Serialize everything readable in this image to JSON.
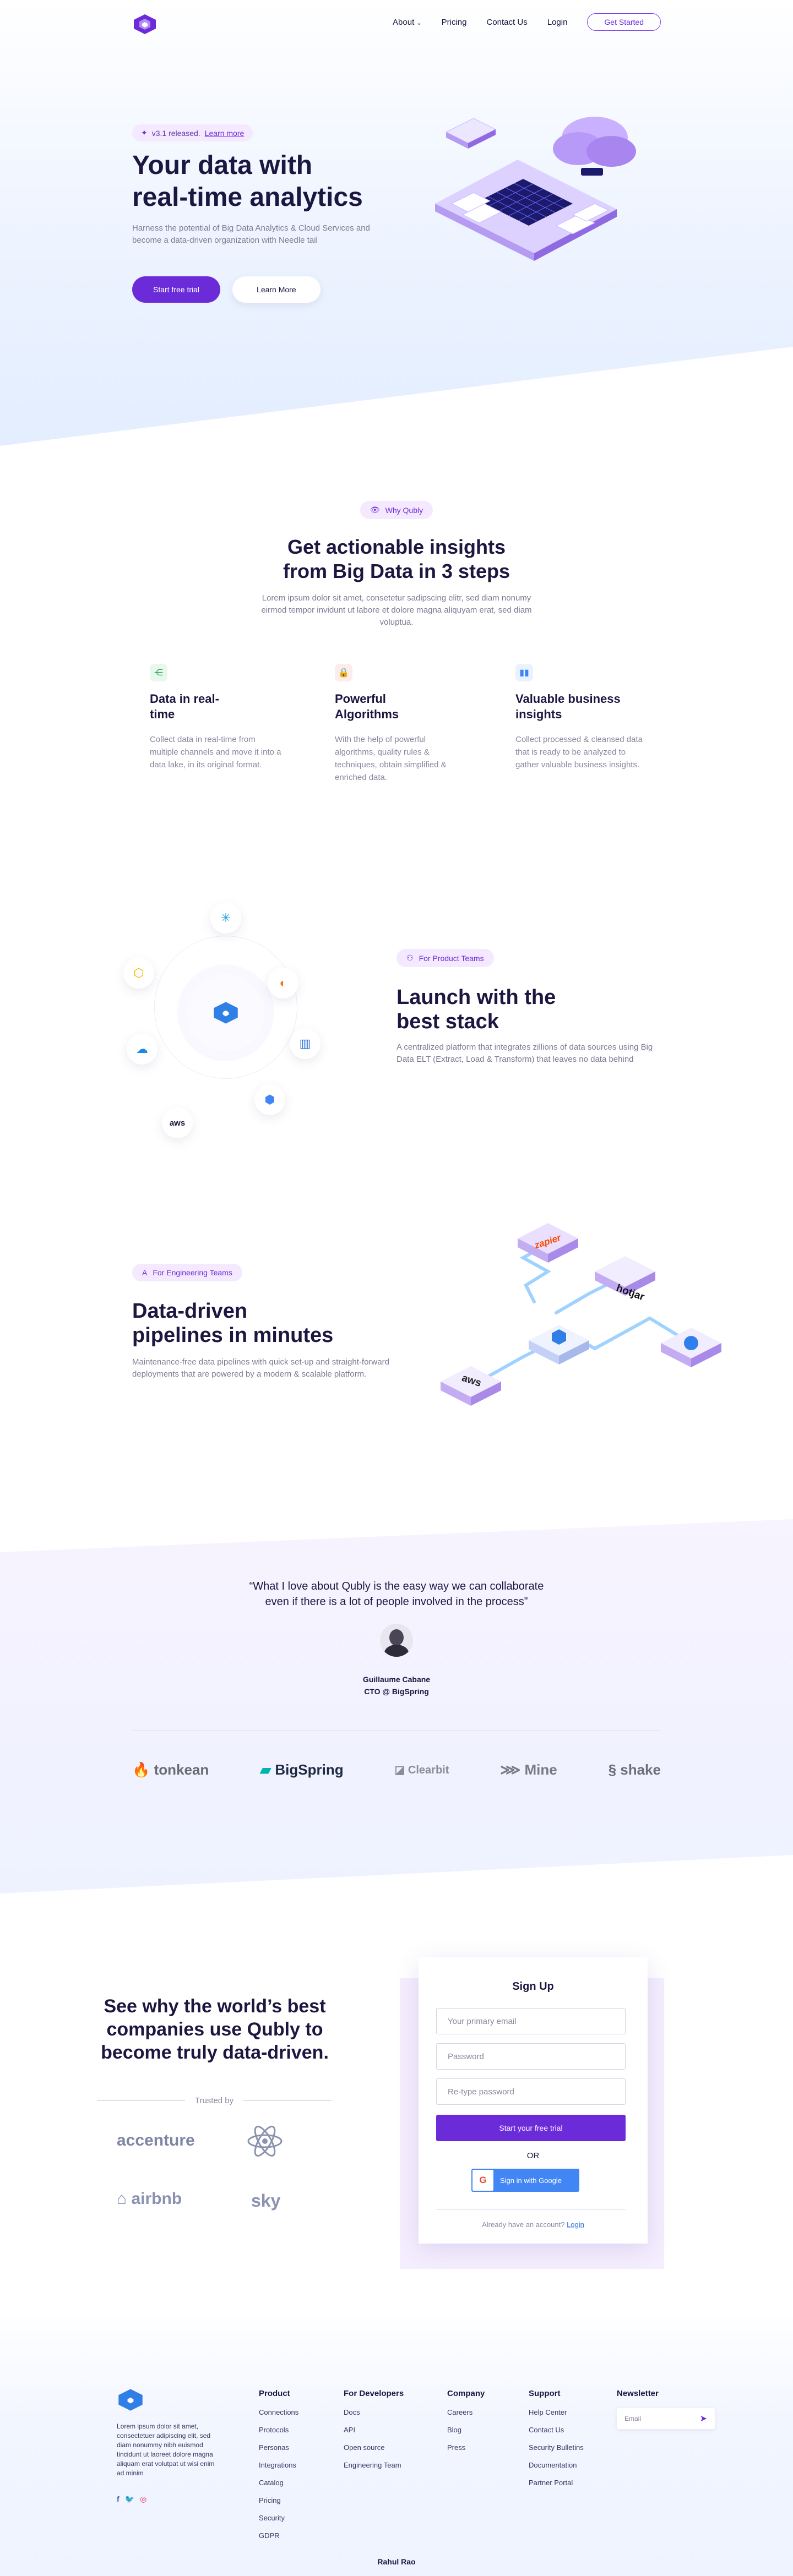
{
  "nav": {
    "links": [
      "About",
      "Pricing",
      "Contact Us",
      "Login"
    ],
    "about_chevron": "⌄",
    "cta": "Get Started"
  },
  "hero": {
    "badge_text": "v3.1 released.",
    "badge_link": "Learn more",
    "title_line1": "Your data with",
    "title_line2": "real-time analytics",
    "subtitle": "Harness the potential of Big Data Analytics & Cloud Services and become a data-driven organization with Needle tail",
    "primary_button": "Start free trial",
    "secondary_button": "Learn More"
  },
  "why": {
    "tag": "Why Qubly",
    "title_line1": "Get actionable insights",
    "title_line2": "from Big Data in 3 steps",
    "description": "Lorem ipsum dolor sit amet, consetetur sadipscing elitr, sed diam nonumy eirmod tempor invidunt ut labore et dolore magna aliquyam erat, sed diam voluptua.",
    "features": [
      {
        "title_line1": "Data in real-",
        "title_line2": "time",
        "text": "Collect data in real-time from multiple channels and move it into a data lake, in its original format.",
        "icon": "share-icon",
        "color": "#27a745"
      },
      {
        "title_line1": "Powerful",
        "title_line2": "Algorithms",
        "text": "With the help of powerful algorithms, quality rules & techniques, obtain simplified & enriched data.",
        "icon": "lock-icon",
        "color": "#e5484d"
      },
      {
        "title_line1": "Valuable business",
        "title_line2": "insights",
        "text": "Collect processed & cleansed data that is ready to be analyzed to gather valuable business insights.",
        "icon": "bar-chart-icon",
        "color": "#3b82f6"
      }
    ]
  },
  "stack": {
    "tag": "For Product Teams",
    "title_line1": "Launch with the",
    "title_line2": "best stack",
    "description": "A centralized platform that integrates zillions of data sources using Big Data ELT (Extract, Load & Transform) that leaves no data behind",
    "aws_label": "aws"
  },
  "pipelines": {
    "tag": "For Engineering Teams",
    "title_line1": "Data-driven",
    "title_line2": "pipelines in minutes",
    "description": "Maintenance-free data pipelines with quick set-up and straight-forward deployments that are powered by a modern & scalable platform.",
    "tiles": [
      "zapier",
      "hotjar",
      "aws"
    ]
  },
  "testimonial": {
    "quote_line1": "“What I love about Qubly is the easy way we can collaborate",
    "quote_line2": "even if there is a lot of people involved in the process”",
    "name": "Guillaume Cabane",
    "role": "CTO @ BigSpring",
    "logos": [
      "tonkean",
      "BigSpring",
      "Clearbit",
      "Mine",
      "shake"
    ]
  },
  "signup": {
    "heading_line1": "See why the world’s best",
    "heading_line2": "companies use Qubly to",
    "heading_line3": "become truly data-driven.",
    "trusted_by": "Trusted by",
    "trusted_logos": [
      "accenture",
      "react",
      "airbnb",
      "sky"
    ],
    "form_title": "Sign Up",
    "email_placeholder": "Your primary email",
    "password_placeholder": "Password",
    "retype_placeholder": "Re-type password",
    "submit": "Start your free trial",
    "or": "OR",
    "google": "Sign in with Google",
    "already": "Already have an account?",
    "login": "Login"
  },
  "footer": {
    "about": "Lorem ipsum dolor sit amet, consectetuer adipiscing elit, sed diam nonummy nibh euismod tincidunt ut laoreet dolore magna aliquam erat volutpat ut wisi enim ad minim",
    "columns": [
      {
        "title": "Product",
        "links": [
          "Connections",
          "Protocols",
          "Personas",
          "Integrations",
          "Catalog",
          "Pricing",
          "Security",
          "GDPR"
        ]
      },
      {
        "title": "For Developers",
        "links": [
          "Docs",
          "API",
          "Open source",
          "Engineering Team"
        ]
      },
      {
        "title": "Company",
        "links": [
          "Careers",
          "Blog",
          "Press"
        ]
      },
      {
        "title": "Support",
        "links": [
          "Help Center",
          "Contact Us",
          "Security Bulletins",
          "Documentation",
          "Partner Portal"
        ]
      }
    ],
    "newsletter_title": "Newsletter",
    "newsletter_placeholder": "Email",
    "credit": "Rahul Rao"
  },
  "colors": {
    "primary": "#6c2bd9",
    "text": "#1c1740",
    "muted": "#7d7a93"
  }
}
